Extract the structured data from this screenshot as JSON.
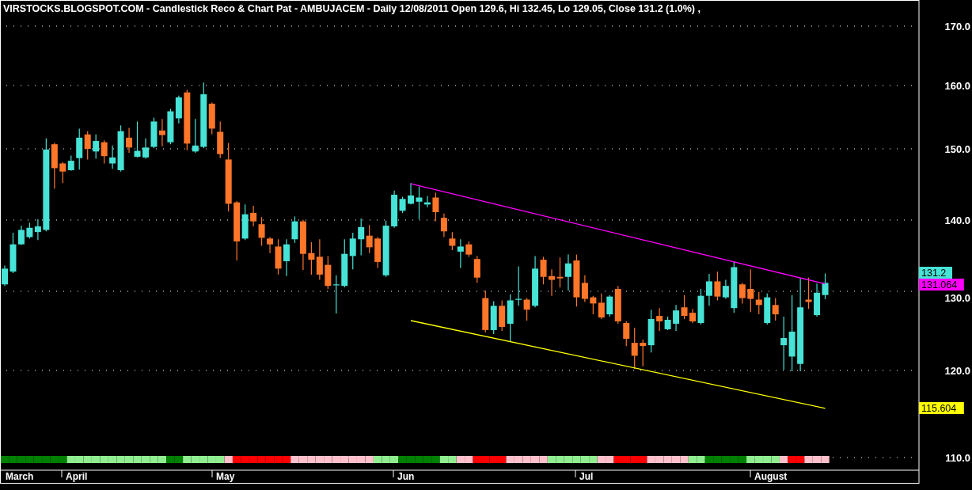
{
  "title": "VIRSTOCKS.BLOGSPOT.COM - Candlestick Reco & Chart Pat - AMBUJACEM - Daily 12/08/2011 Open 129.6, Hi 132.45, Lo 129.05, Close 131.2 (1.0%) ,",
  "price_axis": [
    "170.0",
    "160.0",
    "150.0",
    "140.0",
    "130.0",
    "120.0",
    "110.0"
  ],
  "time_axis": [
    "March",
    "April",
    "May",
    "Jun",
    "Jul",
    "August"
  ],
  "tags": [
    {
      "kind": "last",
      "label": "131.2",
      "color": "#46e3d6"
    },
    {
      "kind": "trendline",
      "label": "131.064",
      "color": "#ff00ff"
    },
    {
      "kind": "trendline",
      "label": "115.604",
      "color": "#ffff00"
    }
  ],
  "signal_strip": [
    {
      "color": "#008000"
    },
    {
      "color": "#008000"
    },
    {
      "color": "#008000"
    },
    {
      "color": "#008000"
    },
    {
      "color": "#008000"
    },
    {
      "color": "#008000"
    },
    {
      "color": "#008000"
    },
    {
      "color": "#008000"
    },
    {
      "color": "#90ee90"
    },
    {
      "color": "#90ee90"
    },
    {
      "color": "#90ee90"
    },
    {
      "color": "#90ee90"
    },
    {
      "color": "#90ee90"
    },
    {
      "color": "#90ee90"
    },
    {
      "color": "#90ee90"
    },
    {
      "color": "#90ee90"
    },
    {
      "color": "#90ee90"
    },
    {
      "color": "#90ee90"
    },
    {
      "color": "#90ee90"
    },
    {
      "color": "#90ee90"
    },
    {
      "color": "#008000"
    },
    {
      "color": "#008000"
    },
    {
      "color": "#90ee90"
    },
    {
      "color": "#90ee90"
    },
    {
      "color": "#90ee90"
    },
    {
      "color": "#90ee90"
    },
    {
      "color": "#90ee90"
    },
    {
      "color": "#ffc0cb"
    },
    {
      "color": "#ff0000"
    },
    {
      "color": "#ff0000"
    },
    {
      "color": "#ff0000"
    },
    {
      "color": "#ff0000"
    },
    {
      "color": "#ff0000"
    },
    {
      "color": "#ff0000"
    },
    {
      "color": "#ff0000"
    },
    {
      "color": "#ffc0cb"
    },
    {
      "color": "#ffc0cb"
    },
    {
      "color": "#ffc0cb"
    },
    {
      "color": "#ffc0cb"
    },
    {
      "color": "#ffc0cb"
    },
    {
      "color": "#ffc0cb"
    },
    {
      "color": "#ffc0cb"
    },
    {
      "color": "#ffc0cb"
    },
    {
      "color": "#ffc0cb"
    },
    {
      "color": "#ffc0cb"
    },
    {
      "color": "#90ee90"
    },
    {
      "color": "#90ee90"
    },
    {
      "color": "#90ee90"
    },
    {
      "color": "#008000"
    },
    {
      "color": "#008000"
    },
    {
      "color": "#008000"
    },
    {
      "color": "#008000"
    },
    {
      "color": "#008000"
    },
    {
      "color": "#90ee90"
    },
    {
      "color": "#90ee90"
    },
    {
      "color": "#ffc0cb"
    },
    {
      "color": "#ffc0cb"
    },
    {
      "color": "#ff0000"
    },
    {
      "color": "#ff0000"
    },
    {
      "color": "#ff0000"
    },
    {
      "color": "#ff0000"
    },
    {
      "color": "#ffc0cb"
    },
    {
      "color": "#ffc0cb"
    },
    {
      "color": "#ffc0cb"
    },
    {
      "color": "#ffc0cb"
    },
    {
      "color": "#ffc0cb"
    },
    {
      "color": "#90ee90"
    },
    {
      "color": "#90ee90"
    },
    {
      "color": "#90ee90"
    },
    {
      "color": "#90ee90"
    },
    {
      "color": "#90ee90"
    },
    {
      "color": "#90ee90"
    },
    {
      "color": "#ffc0cb"
    },
    {
      "color": "#ffc0cb"
    },
    {
      "color": "#ff0000"
    },
    {
      "color": "#ff0000"
    },
    {
      "color": "#ff0000"
    },
    {
      "color": "#ff0000"
    },
    {
      "color": "#ffc0cb"
    },
    {
      "color": "#ffc0cb"
    },
    {
      "color": "#ffc0cb"
    },
    {
      "color": "#ffc0cb"
    },
    {
      "color": "#ffc0cb"
    },
    {
      "color": "#90ee90"
    },
    {
      "color": "#90ee90"
    },
    {
      "color": "#008000"
    },
    {
      "color": "#008000"
    },
    {
      "color": "#008000"
    },
    {
      "color": "#008000"
    },
    {
      "color": "#008000"
    },
    {
      "color": "#90ee90"
    },
    {
      "color": "#90ee90"
    },
    {
      "color": "#90ee90"
    },
    {
      "color": "#90ee90"
    },
    {
      "color": "#ffc0cb"
    },
    {
      "color": "#ff0000"
    },
    {
      "color": "#ff0000"
    },
    {
      "color": "#ffc0cb"
    },
    {
      "color": "#ffc0cb"
    },
    {
      "color": "#ffc0cb"
    }
  ]
}
